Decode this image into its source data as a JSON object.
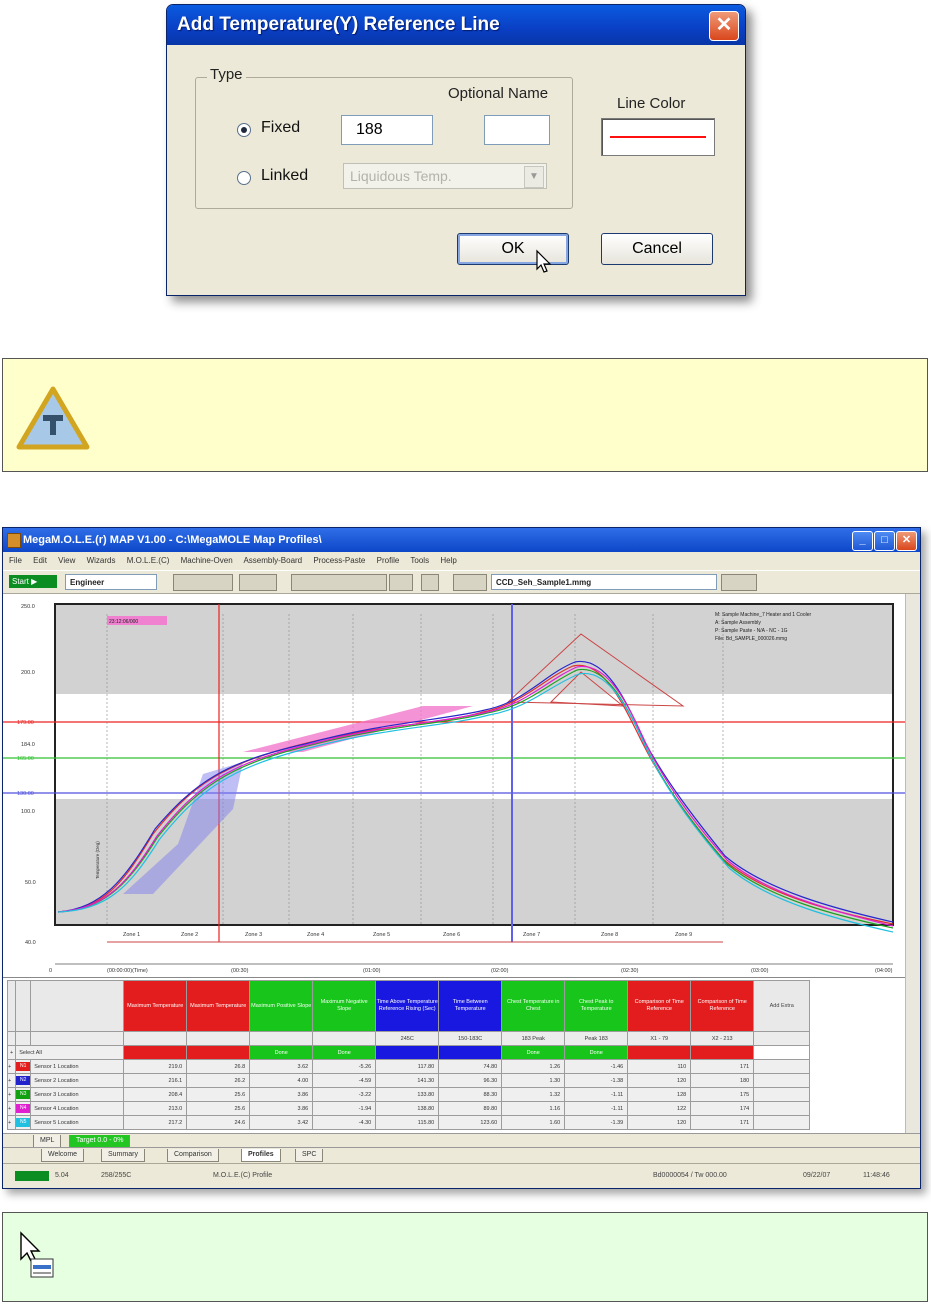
{
  "dialog": {
    "title": "Add Temperature(Y) Reference Line",
    "close_glyph": "✕",
    "type_group_label": "Type",
    "optional_name_label": "Optional Name",
    "fixed_label": "Fixed",
    "fixed_value": "188",
    "optional_name_value": "",
    "linked_label": "Linked",
    "linked_combo_value": "Liquidous Temp.",
    "line_color_label": "Line Color",
    "line_color": "#ff1010",
    "ok_label": "OK",
    "cancel_label": "Cancel",
    "fixed_selected": true
  },
  "notes": {
    "warning_icon": "warning-triangle-icon",
    "pointer_icon": "cursor-pointer-icon"
  },
  "app": {
    "title": "MegaM.O.L.E.(r) MAP V1.00 - C:\\MegaMOLE Map Profiles\\",
    "menu": [
      "File",
      "Edit",
      "View",
      "Wizards",
      "M.O.L.E.(C)",
      "Machine-Oven",
      "Assembly-Board",
      "Process-Paste",
      "Profile",
      "Tools",
      "Help"
    ],
    "toolbar": {
      "start_label": "Start ▶",
      "mode_combo": "Engineer",
      "file_combo": "CCD_Seh_Sample1.mmg"
    },
    "chart": {
      "badge": "23:12:06/000",
      "legend_lines": [
        "M: Sample Machine_7 Heater and 1 Cooler",
        "A: Sample Assembly",
        "P: Sample Paste - N/A - NC - 1G",
        "File: Bd_SAMPLE_000026.mmg"
      ],
      "y_ticks": [
        "250.0",
        "200.0",
        "179.00",
        "184.0",
        "165.00",
        "130.00",
        "100.0",
        "50.0",
        "40.0"
      ],
      "x_ticks": [
        "0",
        "(00:00:00)(Time)",
        "(00:30)",
        "(01:00)",
        "(02:00)",
        "(02:30)",
        "(03:00)",
        "(04:00)"
      ],
      "zones": [
        "Zone 1",
        "Zone 2",
        "Zone 3",
        "Zone 4",
        "Zone 5",
        "Zone 6",
        "Zone 7",
        "Zone 8",
        "Zone 9"
      ],
      "y_axis_label": "Temperature (Deg)"
    },
    "grid": {
      "headers": [
        {
          "text": "Maximum Temperature",
          "color": "red"
        },
        {
          "text": "Maximum Temperature",
          "color": "red"
        },
        {
          "text": "Maximum Positive Slope",
          "color": "green"
        },
        {
          "text": "Maximum Negative Slope",
          "color": "green"
        },
        {
          "text": "Time Above Temperature Reference Rising (Sec)",
          "color": "blue"
        },
        {
          "text": "Time Between Temperature",
          "color": "blue"
        },
        {
          "text": "Chest Temperature in Chest",
          "color": "green"
        },
        {
          "text": "Chest Peak to Temperature",
          "color": "green"
        },
        {
          "text": "Comparison of Time Reference",
          "color": "red"
        },
        {
          "text": "Comparison of Time Reference",
          "color": "red"
        },
        {
          "text": "Add Extra",
          "color": "grey"
        }
      ],
      "sub_values": [
        "",
        "",
        "",
        "",
        "245C",
        "150-183C",
        "183 Peak",
        "Peak 183",
        "X1 - 79",
        "X2 - 213",
        ""
      ],
      "status_values": [
        "",
        "",
        "Done",
        "Done",
        "",
        "",
        "Done",
        "Done",
        "",
        "",
        ""
      ],
      "status_colors": [
        "red",
        "red",
        "green",
        "green",
        "blue",
        "blue",
        "green",
        "green",
        "red",
        "red",
        "blank"
      ],
      "select_all_label": "Select All",
      "rows": [
        {
          "tag": "N1",
          "color": "#e31d1d",
          "name": "Sensor 1 Location",
          "vals": [
            "219.0",
            "26.8",
            "3.62",
            "-5.26",
            "117.80",
            "74.80",
            "1.26",
            "-1.46",
            "110",
            "171"
          ]
        },
        {
          "tag": "N2",
          "color": "#2222cc",
          "name": "Sensor 2 Location",
          "vals": [
            "216.1",
            "26.2",
            "4.00",
            "-4.59",
            "141.30",
            "96.30",
            "1.30",
            "-1.38",
            "120",
            "180"
          ]
        },
        {
          "tag": "N3",
          "color": "#10a010",
          "name": "Sensor 3 Location",
          "vals": [
            "208.4",
            "25.6",
            "3.86",
            "-3.22",
            "133.80",
            "88.30",
            "1.32",
            "-1.11",
            "128",
            "175"
          ]
        },
        {
          "tag": "N4",
          "color": "#e020d0",
          "name": "Sensor 4 Location",
          "vals": [
            "213.0",
            "25.6",
            "3.86",
            "-1.94",
            "138.80",
            "89.80",
            "1.16",
            "-1.11",
            "122",
            "174"
          ]
        },
        {
          "tag": "N5",
          "color": "#20c0e0",
          "name": "Sensor 5 Location",
          "vals": [
            "217.2",
            "24.6",
            "3.42",
            "-4.30",
            "115.80",
            "123.60",
            "1.60",
            "-1.39",
            "120",
            "171"
          ]
        }
      ]
    },
    "bottom_tabs_1": [
      "MPL",
      "Target 0.0 - 0%"
    ],
    "bottom_tabs_2": [
      "Welcome",
      "Summary",
      "Comparison",
      "Profiles",
      "SPC"
    ],
    "status": [
      "5.04",
      "258/255C",
      "M.O.L.E.(C) Profile",
      "Bd0000054 / Tw 000.00",
      "09/22/07",
      "11:48:46"
    ]
  }
}
